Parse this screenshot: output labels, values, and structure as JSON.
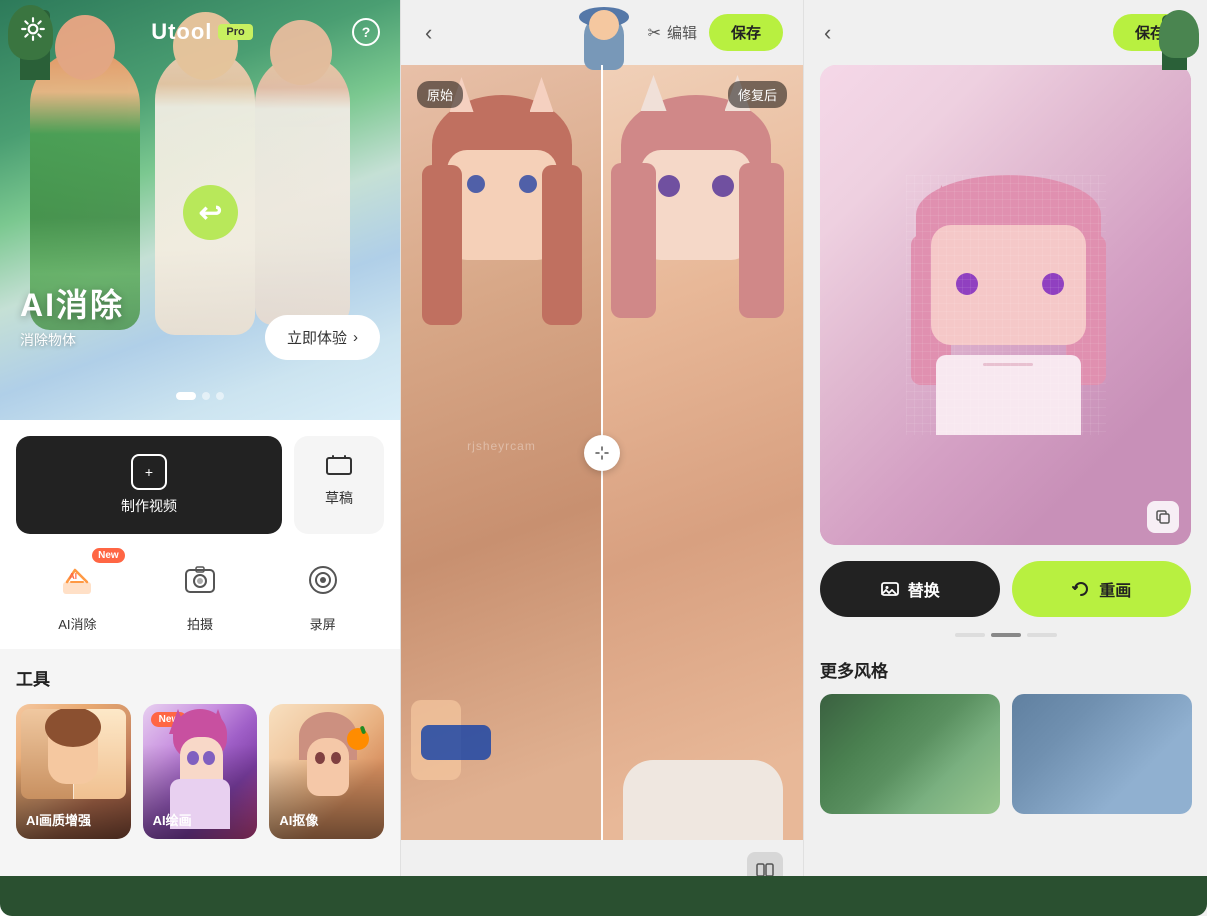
{
  "app": {
    "name": "Utool",
    "pro_badge": "Pro",
    "help_label": "?",
    "settings_icon": "⚙"
  },
  "hero": {
    "title": "AI消除",
    "subtitle": "消除物体",
    "try_button": "立即体验",
    "try_arrow": "›",
    "dots": [
      true,
      false,
      false
    ]
  },
  "actions": {
    "create_video_label": "制作视频",
    "draft_label": "草稿",
    "plus_icon": "+"
  },
  "quick_tools": [
    {
      "label": "AI消除",
      "icon": "✏️",
      "new": true
    },
    {
      "label": "拍摄",
      "icon": "📷",
      "new": false
    },
    {
      "label": "录屏",
      "icon": "⊙",
      "new": false
    }
  ],
  "tools_section": {
    "label": "工具",
    "items": [
      {
        "label": "AI画质增强",
        "new": false
      },
      {
        "label": "AI绘画",
        "new": true
      },
      {
        "label": "AI抠像",
        "new": false
      }
    ]
  },
  "middle_panel": {
    "back_label": "‹",
    "edit_label": "编辑",
    "scissors_icon": "✂",
    "save_label": "保存",
    "label_before": "原始",
    "label_after": "修复后"
  },
  "right_panel": {
    "back_label": "‹",
    "save_label": "保存",
    "replace_label": "替换",
    "replace_icon": "🖼",
    "redraw_label": "重画",
    "redraw_icon": "🔄",
    "copy_icon": "⧉",
    "more_styles_label": "更多风格",
    "progress_dots": [
      false,
      true,
      false
    ]
  },
  "watermark": "rjsheyrcam"
}
